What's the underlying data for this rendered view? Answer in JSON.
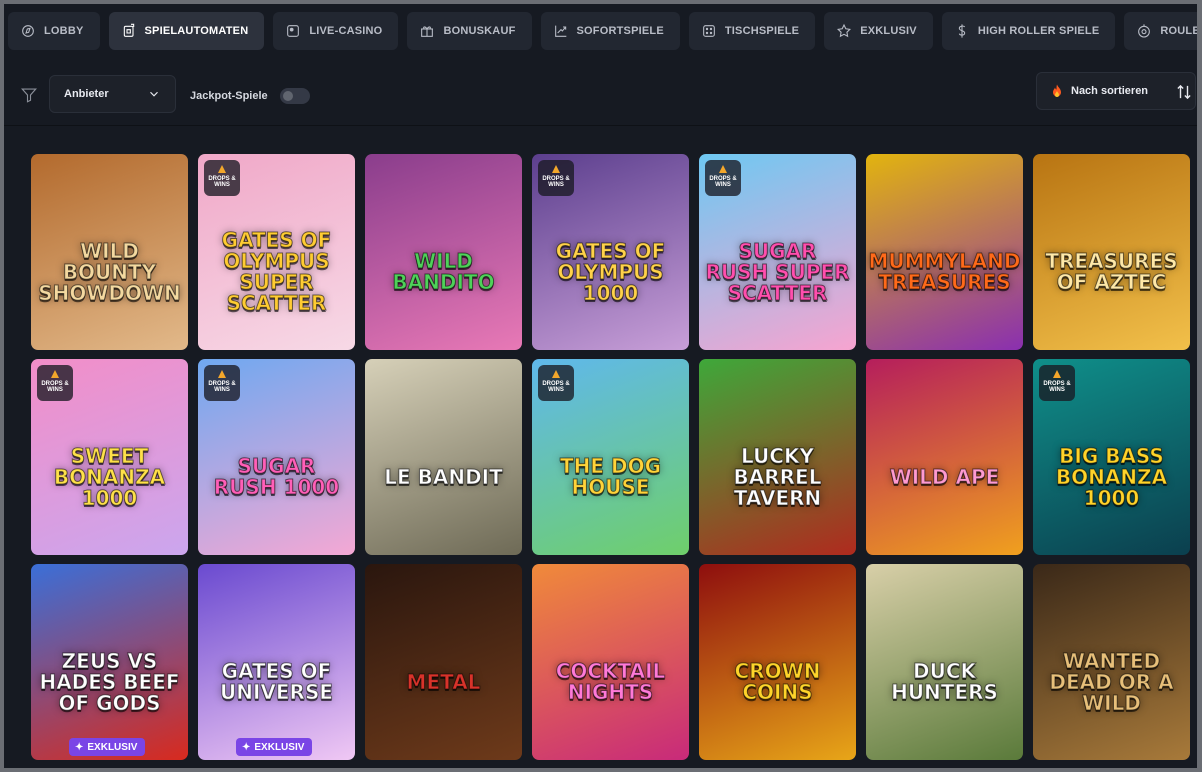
{
  "nav": {
    "tabs": [
      {
        "label": "LOBBY",
        "icon": "lobby-icon"
      },
      {
        "label": "SPIELAUTOMATEN",
        "icon": "slot-machine-icon",
        "active": true
      },
      {
        "label": "LIVE-CASINO",
        "icon": "live-casino-icon"
      },
      {
        "label": "BONUSKAUF",
        "icon": "gift-icon"
      },
      {
        "label": "SOFORTSPIELE",
        "icon": "trend-arrow-icon"
      },
      {
        "label": "TISCHSPIELE",
        "icon": "dice-icon"
      },
      {
        "label": "EXKLUSIV",
        "icon": "star-icon"
      },
      {
        "label": "HIGH ROLLER SPIELE",
        "icon": "dollar-icon"
      },
      {
        "label": "ROULETTE",
        "icon": "roulette-icon"
      }
    ]
  },
  "filters": {
    "provider_label": "Anbieter",
    "jackpot_label": "Jackpot-Spiele",
    "jackpot_enabled": false,
    "sort_label": "Nach sortieren"
  },
  "badges": {
    "drops_wins": "DROPS & WINS",
    "exclusive": "EXKLUSIV"
  },
  "games": [
    {
      "title": "WILD BOUNTY SHOWDOWN",
      "colors": [
        "#b36a2d",
        "#e2b98a"
      ],
      "text": "#f4d9a0"
    },
    {
      "title": "GATES OF OLYMPUS SUPER SCATTER",
      "colors": [
        "#f0a8c8",
        "#f7d9e6"
      ],
      "text": "#ffcc33",
      "drops": true
    },
    {
      "title": "WILD BANDITO",
      "colors": [
        "#8a3d8c",
        "#e879b6"
      ],
      "text": "#4fd15a"
    },
    {
      "title": "GATES OF OLYMPUS 1000",
      "colors": [
        "#5c3f8e",
        "#c89fd8"
      ],
      "text": "#ffd24a",
      "drops": true
    },
    {
      "title": "SUGAR RUSH SUPER SCATTER",
      "colors": [
        "#6ec8f2",
        "#f7a4d0"
      ],
      "text": "#ff4fae",
      "drops": true
    },
    {
      "title": "MUMMYLAND TREASURES",
      "colors": [
        "#e2b40e",
        "#8a2fb0"
      ],
      "text": "#ff6a1a"
    },
    {
      "title": "TREASURES OF AZTEC",
      "colors": [
        "#b87412",
        "#f2c04a"
      ],
      "text": "#ffe9a8"
    },
    {
      "title": "SWEET BONANZA 1000",
      "colors": [
        "#f28ec8",
        "#cba6ee"
      ],
      "text": "#ffe14a",
      "drops": true
    },
    {
      "title": "SUGAR RUSH 1000",
      "colors": [
        "#6fa8f0",
        "#f4a8d4"
      ],
      "text": "#ff5fb8",
      "drops": true
    },
    {
      "title": "LE BANDIT",
      "colors": [
        "#d6d0b8",
        "#6e6a56"
      ],
      "text": "#ffffff"
    },
    {
      "title": "THE DOG HOUSE",
      "colors": [
        "#5fb8ec",
        "#6fcf6a"
      ],
      "text": "#ffd43a",
      "drops": true
    },
    {
      "title": "LUCKY BARREL TAVERN",
      "colors": [
        "#3ea83a",
        "#b02a1e"
      ],
      "text": "#ffffff"
    },
    {
      "title": "WILD APE",
      "colors": [
        "#b51e5c",
        "#f0a01e"
      ],
      "text": "#ff9ad0"
    },
    {
      "title": "BIG BASS BONANZA 1000",
      "colors": [
        "#0f8f8a",
        "#0b3f4e"
      ],
      "text": "#ffd42a",
      "drops": true
    },
    {
      "title": "ZEUS VS HADES BEEF OF GODS",
      "colors": [
        "#3a6fd8",
        "#d82a1e"
      ],
      "text": "#ffffff",
      "exclusive": true
    },
    {
      "title": "GATES OF UNIVERSE",
      "colors": [
        "#6a4ad0",
        "#f0c8f4"
      ],
      "text": "#ffffff",
      "exclusive": true
    },
    {
      "title": "METAL",
      "colors": [
        "#2a160e",
        "#6e3a1a"
      ],
      "text": "#d8332a"
    },
    {
      "title": "COCKTAIL NIGHTS",
      "colors": [
        "#f08a3a",
        "#c82a7a"
      ],
      "text": "#ff7ad8"
    },
    {
      "title": "CROWN COINS",
      "colors": [
        "#8e0e0e",
        "#e8a618"
      ],
      "text": "#ffd42a"
    },
    {
      "title": "DUCK HUNTERS",
      "colors": [
        "#d8cfa8",
        "#5a7a3a"
      ],
      "text": "#ffffff"
    },
    {
      "title": "WANTED DEAD OR A WILD",
      "colors": [
        "#3a2818",
        "#a87a3a"
      ],
      "text": "#e8c07a"
    }
  ]
}
